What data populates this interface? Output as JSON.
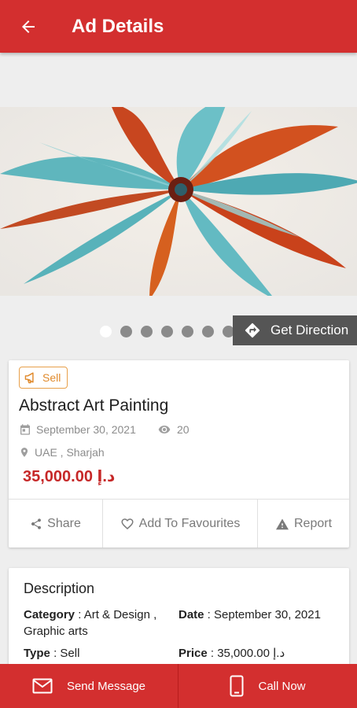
{
  "header": {
    "title": "Ad Details"
  },
  "gallery": {
    "dot_count": 7,
    "active_index": 0
  },
  "get_direction": {
    "label": "Get Direction"
  },
  "ad": {
    "badge": "Sell",
    "title": "Abstract Art Painting",
    "date": "September 30, 2021",
    "views": "20",
    "location": "UAE , Sharjah",
    "price": "35,000.00 د.إ"
  },
  "actions": {
    "share": "Share",
    "favourites": "Add To Favourites",
    "report": "Report"
  },
  "description": {
    "title": "Description",
    "category_label": "Category",
    "category_value": " : Art & Design , Graphic arts",
    "date_label": "Date",
    "date_value": " : September 30, 2021",
    "type_label": "Type",
    "type_value": " : Sell",
    "price_label": "Price",
    "price_value": " : 35,000.00 د.إ"
  },
  "bottom": {
    "send_message": "Send Message",
    "call_now": "Call Now"
  },
  "colors": {
    "primary": "#d32f2f",
    "accent_orange": "#e08a2c",
    "price_red": "#c62828"
  }
}
